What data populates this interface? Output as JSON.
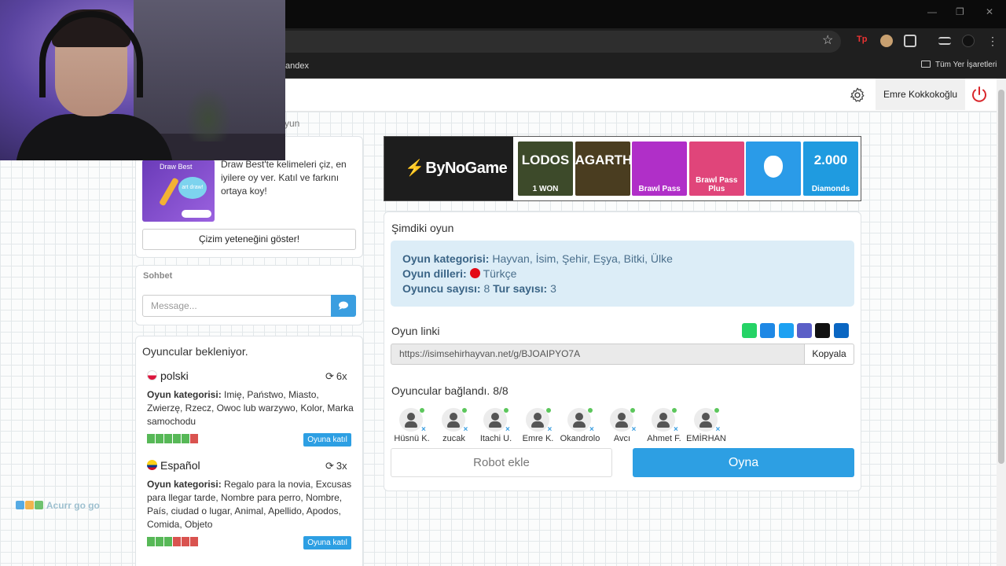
{
  "browser": {
    "bookmark_yandex": "andex",
    "bookmarks_all": "Tüm Yer İşaretleri",
    "window_controls": [
      "—",
      "❐",
      "✕"
    ]
  },
  "header": {
    "user_name": "Emre Kokkokoğlu",
    "breadcrumb_tail": "yun"
  },
  "promo": {
    "image_title": "Draw Best",
    "image_bubble": "art draw!",
    "text": "Draw Best'te kelimeleri çiz, en iyilere oy ver. Katıl ve farkını ortaya koy!",
    "button": "Çizim yeteneğini göster!"
  },
  "chat": {
    "title": "Sohbet",
    "placeholder": "Message..."
  },
  "rooms": {
    "title": "Oyuncular bekleniyor.",
    "items": [
      {
        "language": "polski",
        "count": "6x",
        "category_label": "Oyun kategorisi:",
        "categories": "Imię, Państwo, Miasto, Zwierzę, Rzecz, Owoc lub warzywo, Kolor, Marka samochodu",
        "join": "Oyuna katıl",
        "players_filled": 5,
        "players_total": 6,
        "flag_colors": [
          "#ffffff",
          "#dc143c"
        ]
      },
      {
        "language": "Español",
        "count": "3x",
        "category_label": "Oyun kategorisi:",
        "categories": "Regalo para la novia, Excusas para llegar tarde, Nombre para perro, Nombre, País, ciudad o lugar, Animal, Apellido, Apodos, Comida, Objeto",
        "join": "Oyuna katıl",
        "players_filled": 3,
        "players_total": 6,
        "flag_colors": [
          "#fcd116",
          "#003893"
        ]
      }
    ]
  },
  "ad": {
    "logo": "ByNoGame",
    "tiles": [
      {
        "big": "LODOS",
        "cap": "1 WON",
        "color": "#3d4a2a"
      },
      {
        "big": "AGARTHA",
        "cap": "",
        "color": "#4a3d20"
      },
      {
        "big": "",
        "cap": "Brawl Pass",
        "color": "#b02fc8"
      },
      {
        "big": "",
        "cap": "Brawl Pass Plus",
        "color": "#e0457a"
      },
      {
        "big": "",
        "cap": "",
        "color": "#2a9be8"
      },
      {
        "big": "2.000",
        "cap": "Diamonds",
        "color": "#1f9be0"
      }
    ]
  },
  "current_game": {
    "title": "Şimdiki oyun",
    "category_label": "Oyun kategorisi:",
    "category_value": "Hayvan, İsim, Şehir, Eşya, Bitki, Ülke",
    "languages_label": "Oyun dilleri:",
    "languages_value": "Türkçe",
    "players_label": "Oyuncu sayısı:",
    "players_value": "8",
    "rounds_label": "Tur sayısı:",
    "rounds_value": "3"
  },
  "link": {
    "title": "Oyun linki",
    "url": "https://isimsehirhayvan.net/g/BJOAIPYO7A",
    "copy": "Kopyala",
    "share_icons": [
      {
        "name": "whatsapp-icon",
        "color": "#25d366"
      },
      {
        "name": "messenger-icon",
        "color": "#1e88e5"
      },
      {
        "name": "twitter-icon",
        "color": "#1da1f2"
      },
      {
        "name": "teams-icon",
        "color": "#5b5fc7"
      },
      {
        "name": "snapchat-icon",
        "color": "#111111"
      },
      {
        "name": "share-plus-icon",
        "color": "#0a66c2"
      }
    ]
  },
  "players": {
    "title": "Oyuncular bağlandı. 8/8",
    "list": [
      "Hüsnü K.",
      "zucak",
      "Itachi U.",
      "Emre K.",
      "Okandrolo",
      "Avcı",
      "Ahmet F.",
      "EMİRHAN"
    ]
  },
  "actions": {
    "robot": "Robot ekle",
    "play": "Oyna"
  },
  "watermark": "Acurr go go"
}
